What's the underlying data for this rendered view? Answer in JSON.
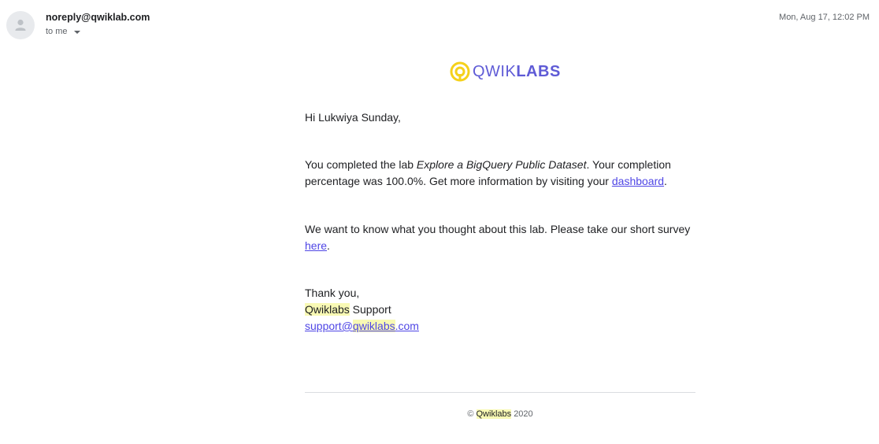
{
  "header": {
    "sender": "noreply@qwiklab.com",
    "recipient": "to me",
    "date": "Mon, Aug 17, 12:02 PM"
  },
  "logo": {
    "text_light": "QWIK",
    "text_bold": "LABS",
    "mark_color": "#f5d11b",
    "text_color": "#5f5bd6"
  },
  "body": {
    "greeting": "Hi Lukwiya Sunday,",
    "completion": {
      "prefix": "You completed the lab ",
      "lab_name": "Explore a BigQuery Public Dataset",
      "middle": ". Your completion percentage was 100.0%. Get more information by visiting your ",
      "link": "dashboard",
      "suffix": "."
    },
    "survey": {
      "prefix": "We want to know what you thought about this lab. Please take our short survey ",
      "link": "here",
      "suffix": "."
    },
    "signoff": {
      "thanks": "Thank you,",
      "company": "Qwiklabs",
      "team": " Support",
      "email_prefix": "support@",
      "email_domain": "qwiklabs",
      "email_tld": ".com"
    }
  },
  "footer": {
    "copyright": "©",
    "company": "Qwiklabs",
    "year": "2020"
  },
  "colors": {
    "link": "#4f46e5",
    "highlight": "#f8f9b4"
  }
}
